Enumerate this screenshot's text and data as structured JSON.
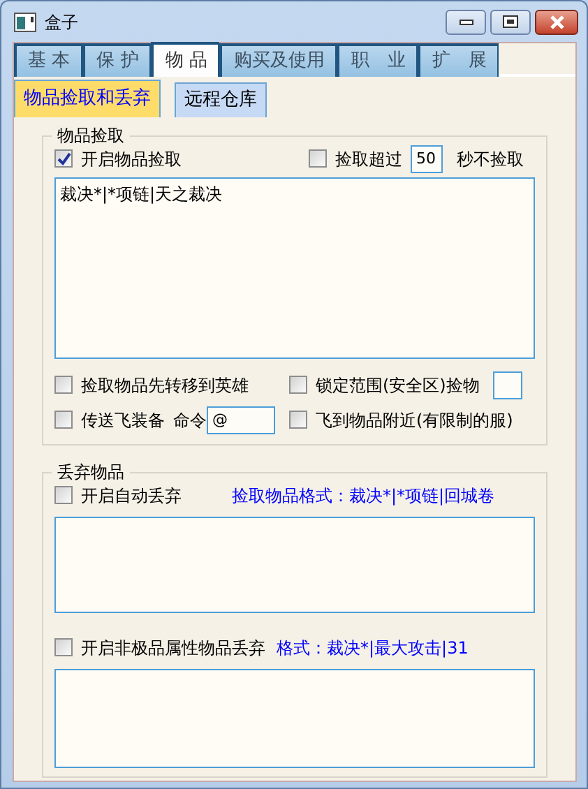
{
  "window": {
    "title": "盒子"
  },
  "tabs": [
    {
      "label": "基 本",
      "selected": false
    },
    {
      "label": "保 护",
      "selected": false
    },
    {
      "label": "物 品",
      "selected": true
    },
    {
      "label": "购买及使用",
      "selected": false
    },
    {
      "label": "职　业",
      "selected": false
    },
    {
      "label": "扩　展",
      "selected": false
    }
  ],
  "subtabs": [
    {
      "label": "物品捡取和丢弃",
      "selected": true
    },
    {
      "label": "远程仓库",
      "selected": false
    }
  ],
  "pickup": {
    "title": "物品捡取",
    "enable": {
      "label": "开启物品捡取",
      "checked": true
    },
    "timeout": {
      "label": "捡取超过",
      "checked": false,
      "value": "50",
      "suffix": "秒不捡取"
    },
    "list": {
      "value": "裁决*|*项链|天之裁决"
    },
    "options": [
      {
        "kind": "checkbox",
        "label": "捡取物品先转移到英雄",
        "checked": false
      },
      {
        "kind": "field-after",
        "label": "锁定范围(安全区)捡物",
        "checked": false
      },
      {
        "kind": "command",
        "label": "传送飞装备",
        "checked": false,
        "command_label": "命令",
        "value": "@"
      },
      {
        "kind": "checkbox",
        "label": "飞到物品附近(有限制的服)",
        "checked": false
      }
    ]
  },
  "discard": {
    "title": "丢弃物品",
    "sections": [
      {
        "label": "开启自动丢弃",
        "checked": false,
        "hint": "捡取物品格式：裁决*|*项链|回城卷"
      },
      {
        "label": "开启非极品属性物品丢弃",
        "checked": false,
        "hint": "格式：裁决*|最大攻击|31"
      }
    ]
  }
}
